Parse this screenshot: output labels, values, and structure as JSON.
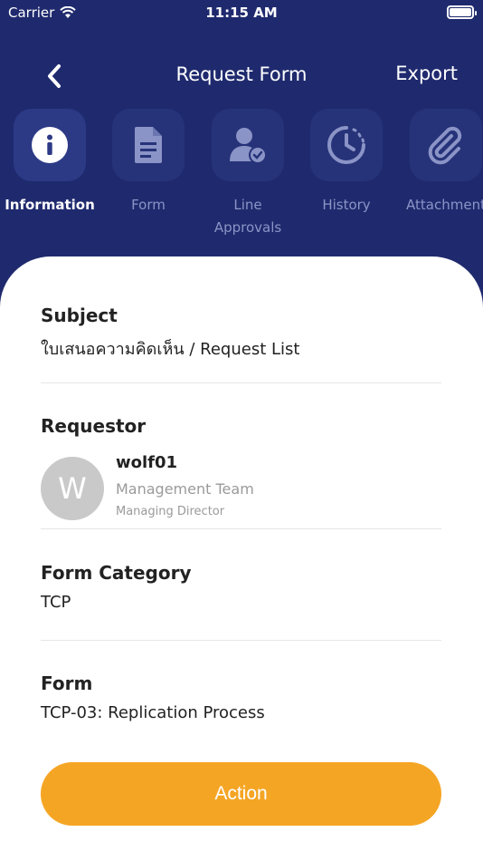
{
  "status_bar": {
    "carrier": "Carrier",
    "time": "11:15 AM"
  },
  "nav": {
    "title": "Request Form",
    "export_label": "Export"
  },
  "tabs": [
    {
      "label": "Information",
      "icon": "info-icon",
      "active": true
    },
    {
      "label": "Form",
      "icon": "document-icon",
      "active": false
    },
    {
      "label": "Line\nApprovals",
      "icon": "user-check-icon",
      "active": false
    },
    {
      "label": "History",
      "icon": "history-clock-icon",
      "active": false
    },
    {
      "label": "Attachment",
      "icon": "paperclip-icon",
      "active": false
    }
  ],
  "fields": {
    "subject": {
      "label": "Subject",
      "value": "ใบเสนอความคิดเห็น / Request List"
    },
    "requestor": {
      "label": "Requestor",
      "initial": "W",
      "name": "wolf01",
      "team": "Management Team",
      "role": "Managing Director"
    },
    "form_category": {
      "label": "Form Category",
      "value": "TCP"
    },
    "form": {
      "label": "Form",
      "value": "TCP-03: Replication Process"
    }
  },
  "action_label": "Action",
  "colors": {
    "header_bg": "#1f2a6e",
    "tab_box": "#263379",
    "accent": "#f5a524"
  }
}
